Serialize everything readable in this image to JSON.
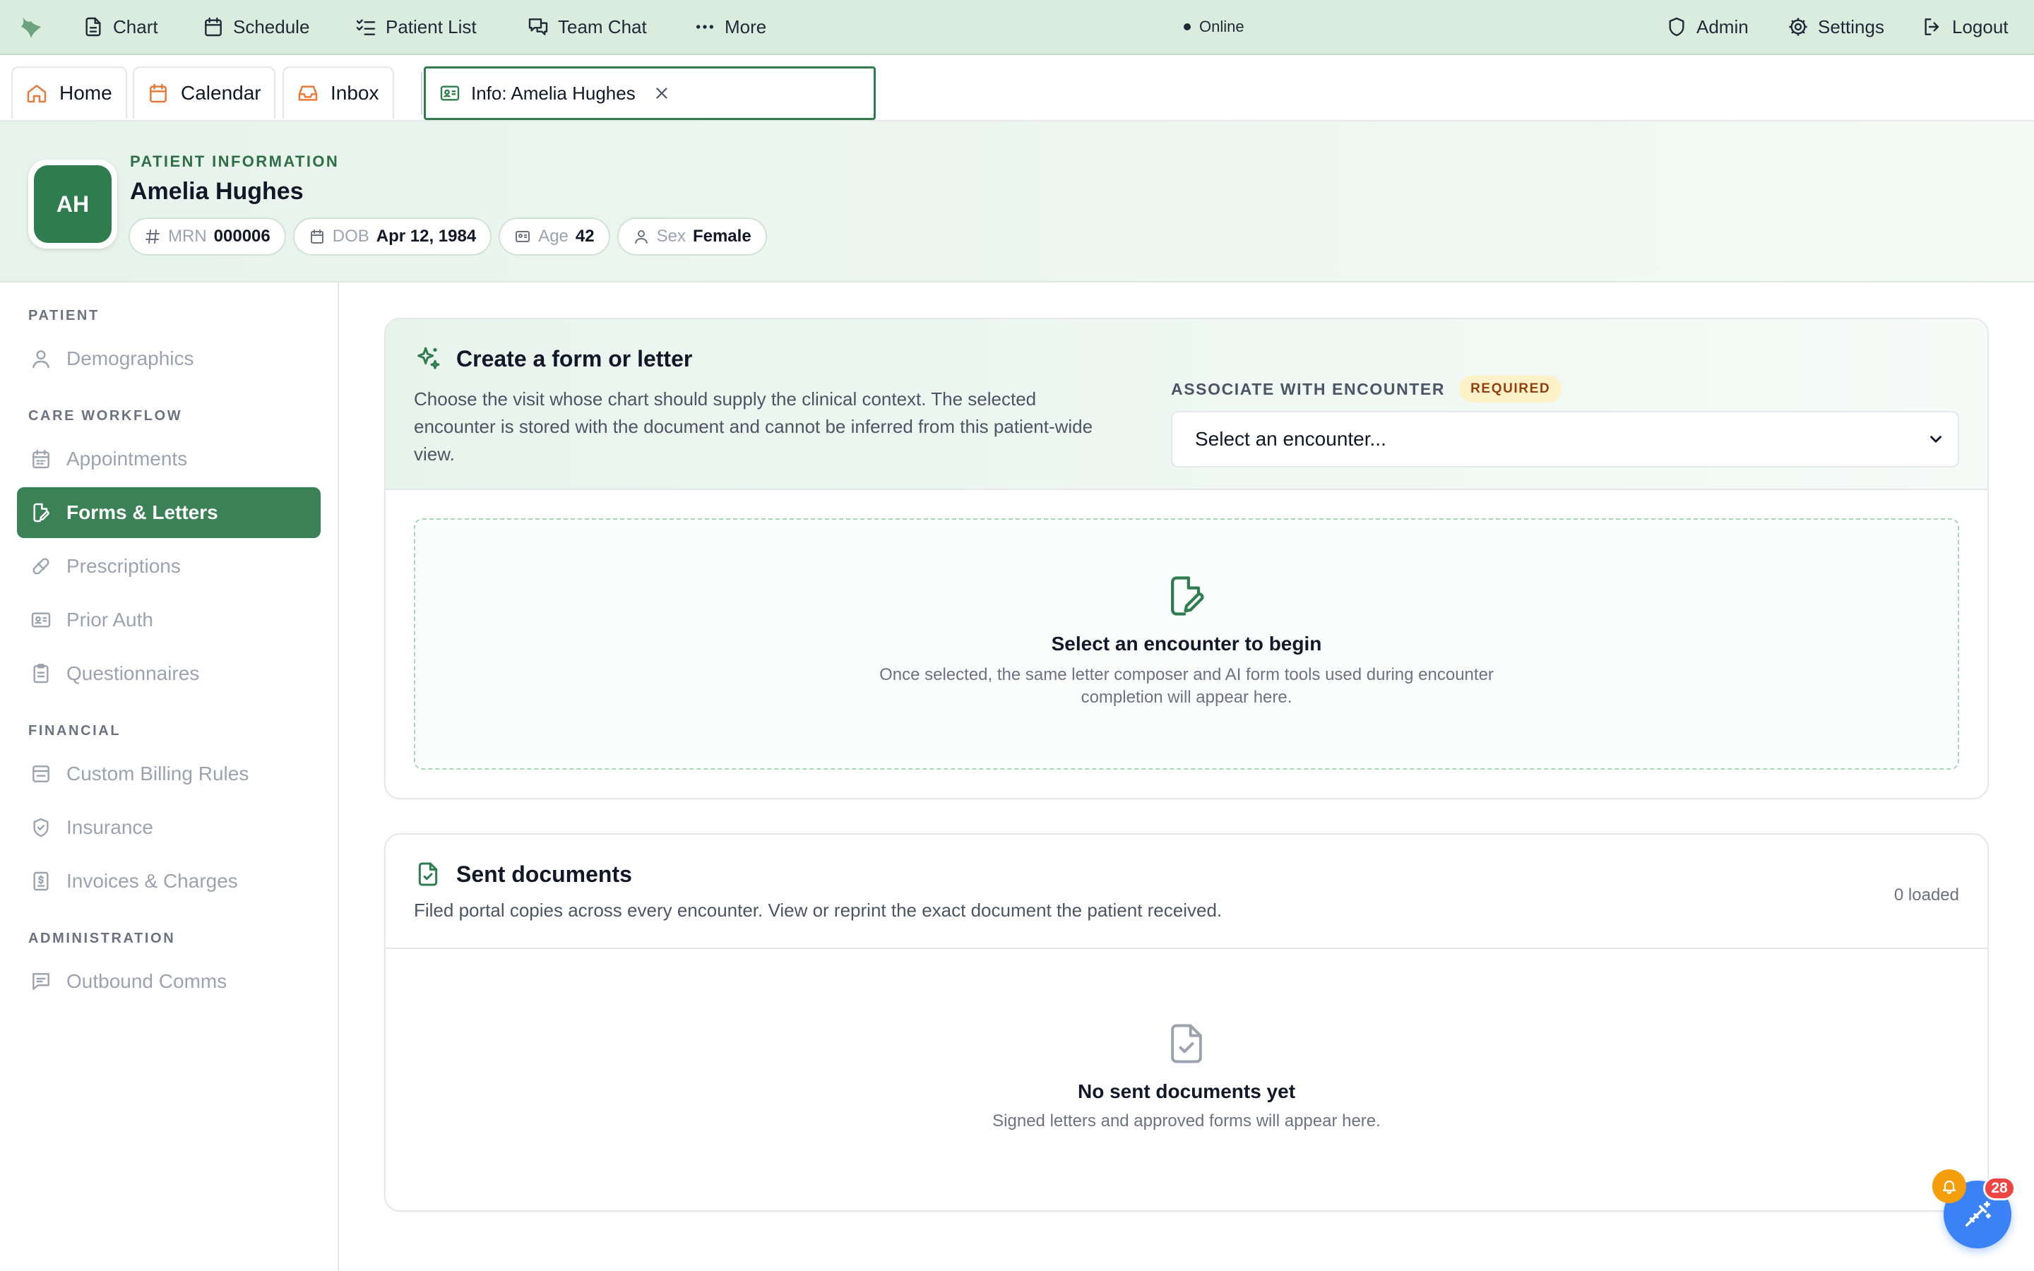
{
  "topnav": {
    "items": [
      {
        "label": "Chart",
        "icon": "file-icon"
      },
      {
        "label": "Schedule",
        "icon": "calendar-icon"
      },
      {
        "label": "Patient List",
        "icon": "list-check-icon"
      },
      {
        "label": "Team Chat",
        "icon": "chat-icon"
      },
      {
        "label": "More",
        "icon": "dots-icon"
      }
    ],
    "status": "Online",
    "right": [
      {
        "label": "Admin",
        "icon": "shield-icon"
      },
      {
        "label": "Settings",
        "icon": "gear-icon"
      },
      {
        "label": "Logout",
        "icon": "logout-icon"
      }
    ]
  },
  "tabs": [
    {
      "label": "Home",
      "icon": "home-icon"
    },
    {
      "label": "Calendar",
      "icon": "calendar-icon"
    },
    {
      "label": "Inbox",
      "icon": "inbox-icon"
    },
    {
      "label": "Info: Amelia Hughes",
      "icon": "id-card-icon",
      "active": true
    }
  ],
  "patient": {
    "eyebrow": "PATIENT INFORMATION",
    "initials": "AH",
    "name": "Amelia Hughes",
    "chips": [
      {
        "key": "MRN",
        "value": "000006",
        "icon": "hash-icon"
      },
      {
        "key": "DOB",
        "value": "Apr 12, 1984",
        "icon": "calendar-icon"
      },
      {
        "key": "Age",
        "value": "42",
        "icon": "id-card-icon"
      },
      {
        "key": "Sex",
        "value": "Female",
        "icon": "user-icon"
      }
    ]
  },
  "sidebar": {
    "sections": {
      "patient": "PATIENT",
      "care": "CARE WORKFLOW",
      "financial": "FINANCIAL",
      "admin": "ADMINISTRATION"
    },
    "items": {
      "demographics": "Demographics",
      "appointments": "Appointments",
      "forms": "Forms & Letters",
      "prescriptions": "Prescriptions",
      "prior_auth": "Prior Auth",
      "questionnaires": "Questionnaires",
      "billing_rules": "Custom Billing Rules",
      "insurance": "Insurance",
      "invoices": "Invoices & Charges",
      "outbound": "Outbound Comms"
    }
  },
  "create_card": {
    "title": "Create a form or letter",
    "desc_lines": [
      "Choose the visit whose chart should supply the clinical context. The selected",
      "encounter is stored with the document and cannot be inferred from this patient-wide",
      "view."
    ],
    "assoc_label": "ASSOCIATE WITH ENCOUNTER",
    "required_badge": "REQUIRED",
    "select_value": "Select an encounter...",
    "empty_title": "Select an encounter to begin",
    "empty_sub_lines": [
      "Once selected, the same letter composer and AI form tools used during encounter",
      "completion will appear here."
    ]
  },
  "sent_card": {
    "title": "Sent documents",
    "desc": "Filed portal copies across every encounter. View or reprint the exact document the patient received.",
    "loaded": "0 loaded",
    "empty_title": "No sent documents yet",
    "empty_sub": "Signed letters and approved forms will appear here."
  },
  "floating": {
    "notification_count": "28"
  },
  "colors": {
    "brand": "#2f7d4f",
    "topbar_bg": "#d9ecde",
    "active_nav": "#3a8256",
    "required_bg": "#fdf1c9",
    "fab": "#3b82f6",
    "badge": "#ef4444",
    "bell": "#f59e0b"
  }
}
